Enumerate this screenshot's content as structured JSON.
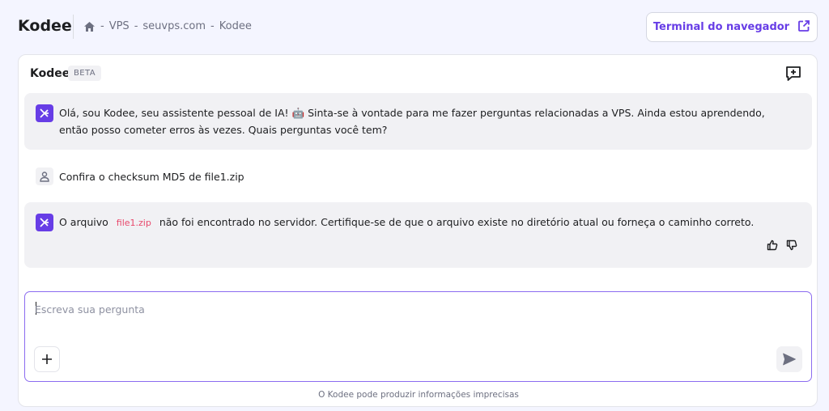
{
  "header": {
    "app_title": "Kodee",
    "breadcrumb": [
      "VPS",
      "seuvps.com",
      "Kodee"
    ],
    "breadcrumb_sep": "-",
    "terminal_button": "Terminal do navegador"
  },
  "panel": {
    "title": "Kodee",
    "badge": "BETA",
    "messages": [
      {
        "role": "ai",
        "text": "Olá, sou Kodee, seu assistente pessoal de IA! 🤖 Sinta-se à vontade para me fazer perguntas relacionadas a VPS. Ainda estou aprendendo, então posso cometer erros às vezes. Quais perguntas você tem?"
      },
      {
        "role": "user",
        "text": "Confira o checksum MD5 de file1.zip"
      },
      {
        "role": "ai",
        "text_before": "O arquivo",
        "code": "file1.zip",
        "text_after": "não foi encontrado no servidor. Certifique-se de que o arquivo existe no diretório atual ou forneça o caminho correto."
      }
    ],
    "input_placeholder": "Escreva sua pergunta",
    "disclaimer": "O Kodee pode produzir informações imprecisas"
  },
  "colors": {
    "accent": "#673de6",
    "code": "#e8486b",
    "background": "#f4f5ff"
  }
}
